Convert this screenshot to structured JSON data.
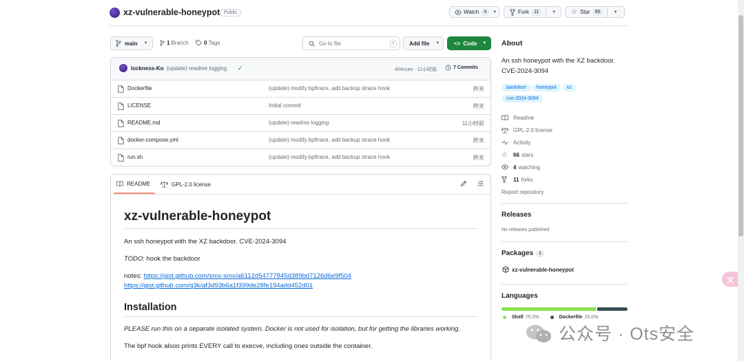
{
  "repo": {
    "name": "xz-vulnerable-honeypot",
    "visibility": "Public"
  },
  "actions": {
    "watch_label": "Watch",
    "watch_count": "4",
    "fork_label": "Fork",
    "fork_count": "11",
    "star_label": "Star",
    "star_count": "66"
  },
  "toolbar": {
    "branch": "main",
    "branches_count": "1",
    "branches_label": "Branch",
    "tags_count": "0",
    "tags_label": "Tags",
    "search_placeholder": "Go to file",
    "search_shortcut": "t",
    "add_file_label": "Add file",
    "code_label": "Code"
  },
  "commit": {
    "author": "lockness-Ko",
    "message": "(update) readme logging",
    "hash_time": "404ccee · 11小时前",
    "commits_count": "7",
    "commits_label": "Commits"
  },
  "files": [
    {
      "name": "Dockerfile",
      "message": "(update) modify bpftrace, add backup strace hook",
      "time": "昨天",
      "type": "file"
    },
    {
      "name": "LICENSE",
      "message": "Initial commit",
      "time": "昨天",
      "type": "file"
    },
    {
      "name": "README.md",
      "message": "(update) readme logging",
      "time": "11小时前",
      "type": "file"
    },
    {
      "name": "docker-compose.yml",
      "message": "(update) modify bpftrace, add backup strace hook",
      "time": "昨天",
      "type": "file"
    },
    {
      "name": "run.sh",
      "message": "(update) modify bpftrace, add backup strace hook",
      "time": "昨天",
      "type": "file"
    }
  ],
  "readme_tabs": {
    "readme": "README",
    "license": "GPL-2.0 license"
  },
  "readme": {
    "title": "xz-vulnerable-honeypot",
    "description": "An ssh honeypot with the XZ backdoor. CVE-2024-3094",
    "todo_label": "TODO",
    "todo_text": ": hook the backdoor",
    "notes_label": "notes: ",
    "note_link_1": "https://gist.github.com/smx-smx/a6112d54777845d389bd7126d6e9f504",
    "note_link_2": "https://gist.github.com/q3k/af3d93b6a1f399de28fe194add452d01",
    "install_heading": "Installation",
    "install_warning": "PLEASE run this on a separate isolated system. Docker is not used for isolation, but for getting the libraries working.",
    "install_note": "The bpf hook alsoo prints EVERY call to execve, including ones outside the container."
  },
  "about": {
    "heading": "About",
    "description": "An ssh honeypot with the XZ backdoor. CVE-2024-3094",
    "topics": [
      "backdoor",
      "honeypot",
      "xz",
      "cve-2024-3094"
    ],
    "readme_label": "Readme",
    "license_label": "GPL-2.0 license",
    "activity_label": "Activity",
    "stars_count": "66",
    "stars_label": "stars",
    "watching_count": "4",
    "watching_label": "watching",
    "forks_count": "11",
    "forks_label": "forks",
    "report_label": "Report repository"
  },
  "releases": {
    "heading": "Releases",
    "empty_text": "No releases published"
  },
  "packages": {
    "heading": "Packages",
    "count": "1",
    "item": "xz-vulnerable-honeypot"
  },
  "languages": {
    "heading": "Languages",
    "items": [
      {
        "name": "Shell",
        "percent": "75.0%",
        "fraction": 0.75,
        "color": "#89e051"
      },
      {
        "name": "Dockerfile",
        "percent": "25.0%",
        "fraction": 0.25,
        "color": "#384d54"
      }
    ]
  },
  "watermark": {
    "text": "公众号 · Ots安全"
  },
  "colors": {
    "code_button": "#1f883d",
    "link": "#0969da",
    "topic_bg": "#ddf4ff",
    "accent_underline": "#fd8c73"
  }
}
